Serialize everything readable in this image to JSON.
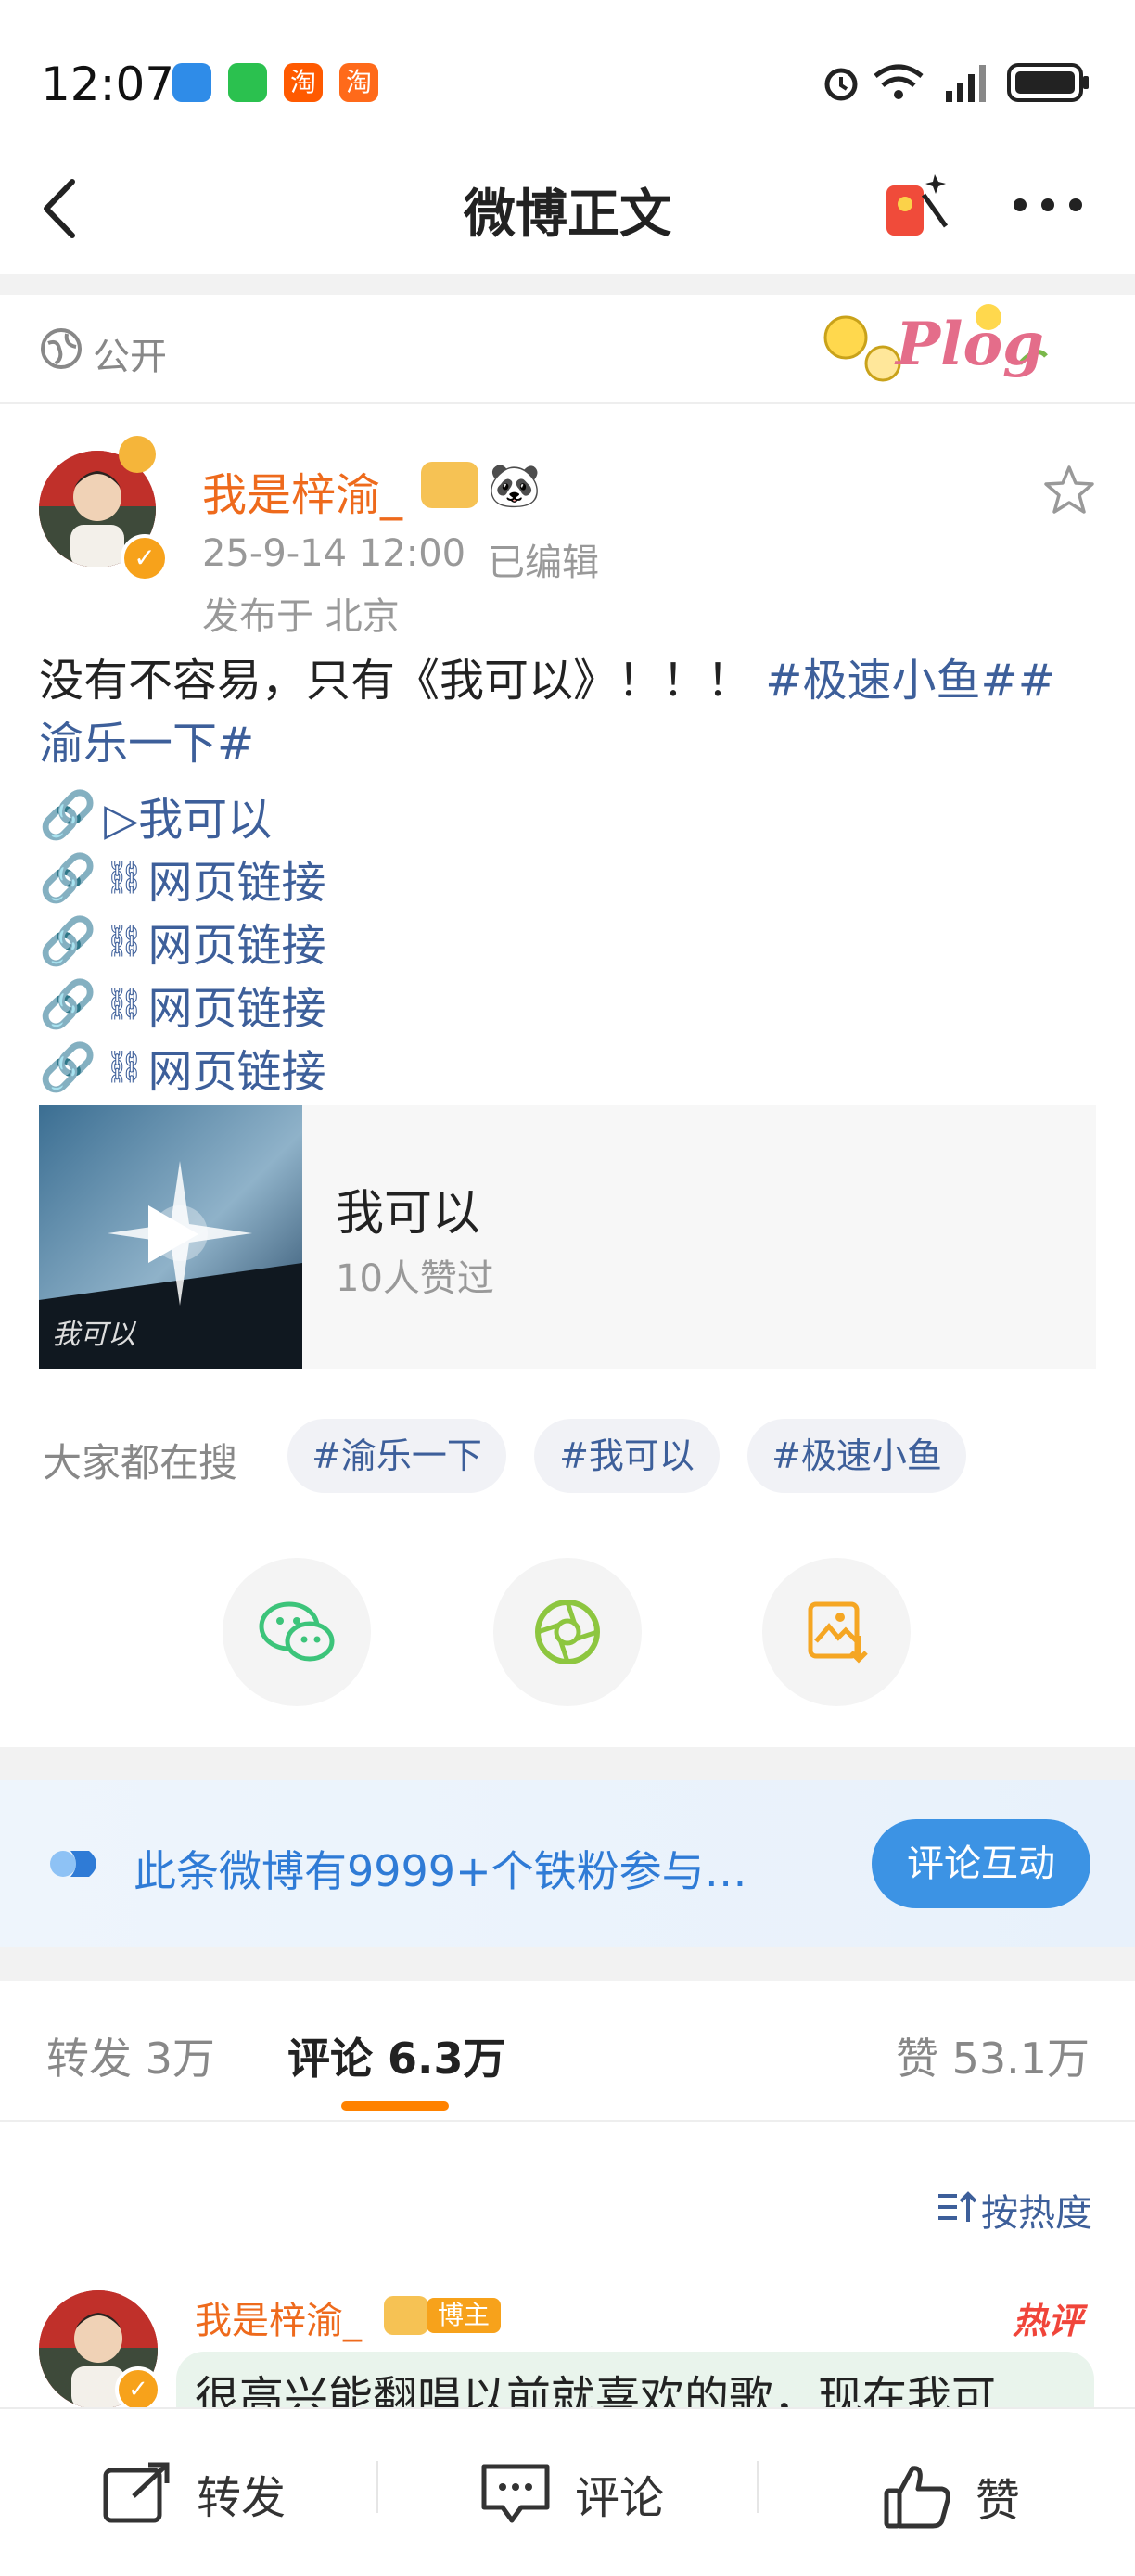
{
  "status_bar": {
    "time": "12:07",
    "app_icon_1": "淘",
    "app_icon_2": "淘"
  },
  "nav": {
    "title": "微博正文"
  },
  "visibility": {
    "label": "公开",
    "plog_badge": "Plog"
  },
  "post": {
    "author": "我是梓渝_",
    "date": "25-9-14 12:00",
    "edited": "已编辑",
    "location": "发布于 北京",
    "text_plain": "没有不容易，只有《我可以》！！！",
    "topic_a": "#极速小鱼##",
    "topic_b": "渝乐一下#",
    "links": [
      {
        "label": "▷我可以"
      },
      {
        "label": "网页链接"
      },
      {
        "label": "网页链接"
      },
      {
        "label": "网页链接"
      },
      {
        "label": "网页链接"
      }
    ],
    "media": {
      "title": "我可以",
      "likes": "10人赞过",
      "cover_text": "我可以"
    }
  },
  "search": {
    "label": "大家都在搜",
    "chips": [
      "#渝乐一下",
      "#我可以",
      "#极速小鱼"
    ]
  },
  "banner": {
    "text": "此条微博有9999+个铁粉参与…",
    "button": "评论互动"
  },
  "tabs": {
    "repost": "转发 3万",
    "comment": "评论 6.3万",
    "like": "赞 53.1万"
  },
  "comments": {
    "sort": "按热度",
    "first": {
      "name": "我是梓渝_",
      "badge": "博主",
      "hot": "热评",
      "text": "很高兴能翻唱以前就喜欢的歌，现在我可"
    }
  },
  "bottom_bar": {
    "repost": "转发",
    "comment": "评论",
    "like": "赞"
  },
  "colors": {
    "orange": "#ee6a1c",
    "topic_blue": "#3d5f9a",
    "accent": "#ff8200",
    "button_blue": "#3c93e4"
  }
}
